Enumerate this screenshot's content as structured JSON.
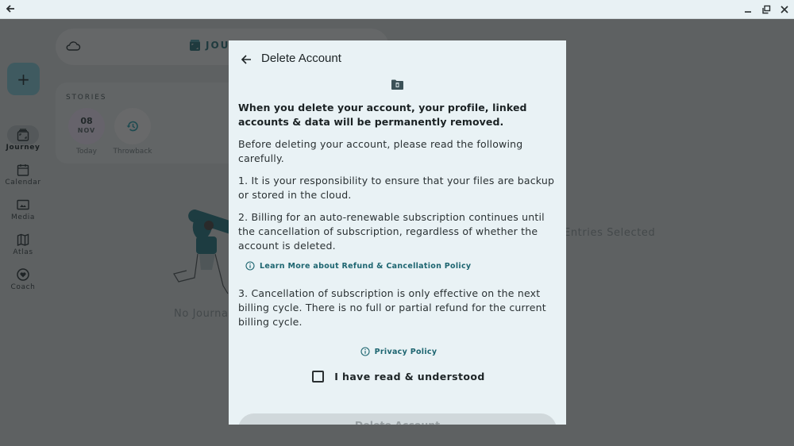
{
  "window": {
    "back_icon": "arrow-left-icon",
    "controls": [
      "minimize-icon",
      "restore-icon",
      "close-icon"
    ]
  },
  "app": {
    "brand_label": "JOURNEY",
    "brand_visible": "JOU",
    "fab_label": "+",
    "nav": [
      {
        "label": "Journey",
        "icon": "journey-icon",
        "active": true
      },
      {
        "label": "Calendar",
        "icon": "calendar-icon",
        "active": false
      },
      {
        "label": "Media",
        "icon": "image-icon",
        "active": false
      },
      {
        "label": "Atlas",
        "icon": "map-icon",
        "active": false
      },
      {
        "label": "Coach",
        "icon": "heart-icon",
        "active": false
      }
    ],
    "stories": {
      "title": "STORIES",
      "today": {
        "day": "08",
        "month": "NOV",
        "caption": "Today"
      },
      "throwback": {
        "caption": "Throwback",
        "icon": "history-icon"
      }
    },
    "empty_left": "No Journal",
    "empty_right": "Entries Selected"
  },
  "dialog": {
    "title": "Delete Account",
    "header_icon": "folder-delete-icon",
    "warning": "When you delete your account, your profile, linked accounts & data will be permanently removed.",
    "intro": "Before deleting your account, please read the following carefully.",
    "point1": "1. It is your responsibility to ensure that your files are backup or stored in the cloud.",
    "point2": "2. Billing for an auto-renewable subscription continues until the cancellation of subscription, regardless of whether the account is deleted.",
    "refund_link": "Learn More about Refund & Cancellation Policy",
    "point3": "3. Cancellation of subscription is only effective on the next billing cycle. There is no full or partial refund for the current billing cycle.",
    "privacy_link": "Privacy Policy",
    "checkbox_label": "I have read & understood",
    "checkbox_checked": false,
    "delete_button": "Delete Account"
  },
  "colors": {
    "accent": "#1d6570",
    "dialog_bg": "#e9f2f5",
    "scrim": "#5e6162",
    "disabled_button": "#d0d8db"
  }
}
